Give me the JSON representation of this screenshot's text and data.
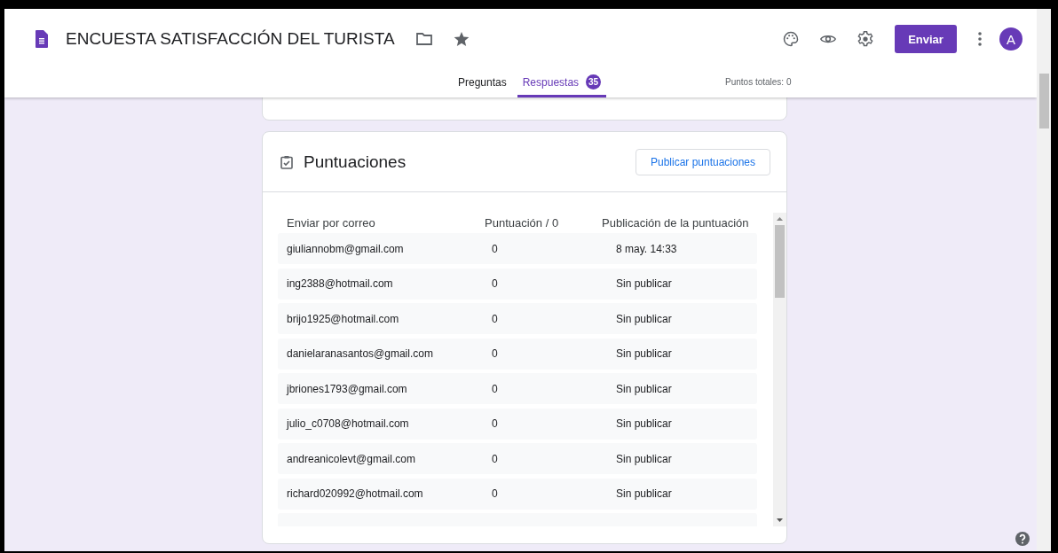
{
  "header": {
    "title": "ENCUESTA SATISFACCIÓN DEL TURISTA",
    "send_button": "Enviar",
    "avatar": "A"
  },
  "tabs": [
    {
      "label": "Preguntas",
      "selected": false
    },
    {
      "label": "Respuestas",
      "selected": true,
      "badge": "35"
    }
  ],
  "total_points": "Puntos totales: 0",
  "scores": {
    "title": "Puntuaciones",
    "publish_button": "Publicar puntuaciones",
    "columns": [
      "Enviar por correo",
      "Puntuación / 0",
      "Publicación de la puntuación"
    ],
    "rows": [
      {
        "email": "giuliannobm@gmail.com",
        "score": "0",
        "status": "8 may. 14:33"
      },
      {
        "email": "ing2388@hotmail.com",
        "score": "0",
        "status": "Sin publicar"
      },
      {
        "email": "brijo1925@hotmail.com",
        "score": "0",
        "status": "Sin publicar"
      },
      {
        "email": "danielaranasantos@gmail.com",
        "score": "0",
        "status": "Sin publicar"
      },
      {
        "email": "jbriones1793@gmail.com",
        "score": "0",
        "status": "Sin publicar"
      },
      {
        "email": "julio_c0708@hotmail.com",
        "score": "0",
        "status": "Sin publicar"
      },
      {
        "email": "andreanicolevt@gmail.com",
        "score": "0",
        "status": "Sin publicar"
      },
      {
        "email": "richard020992@hotmail.com",
        "score": "0",
        "status": "Sin publicar"
      }
    ]
  }
}
